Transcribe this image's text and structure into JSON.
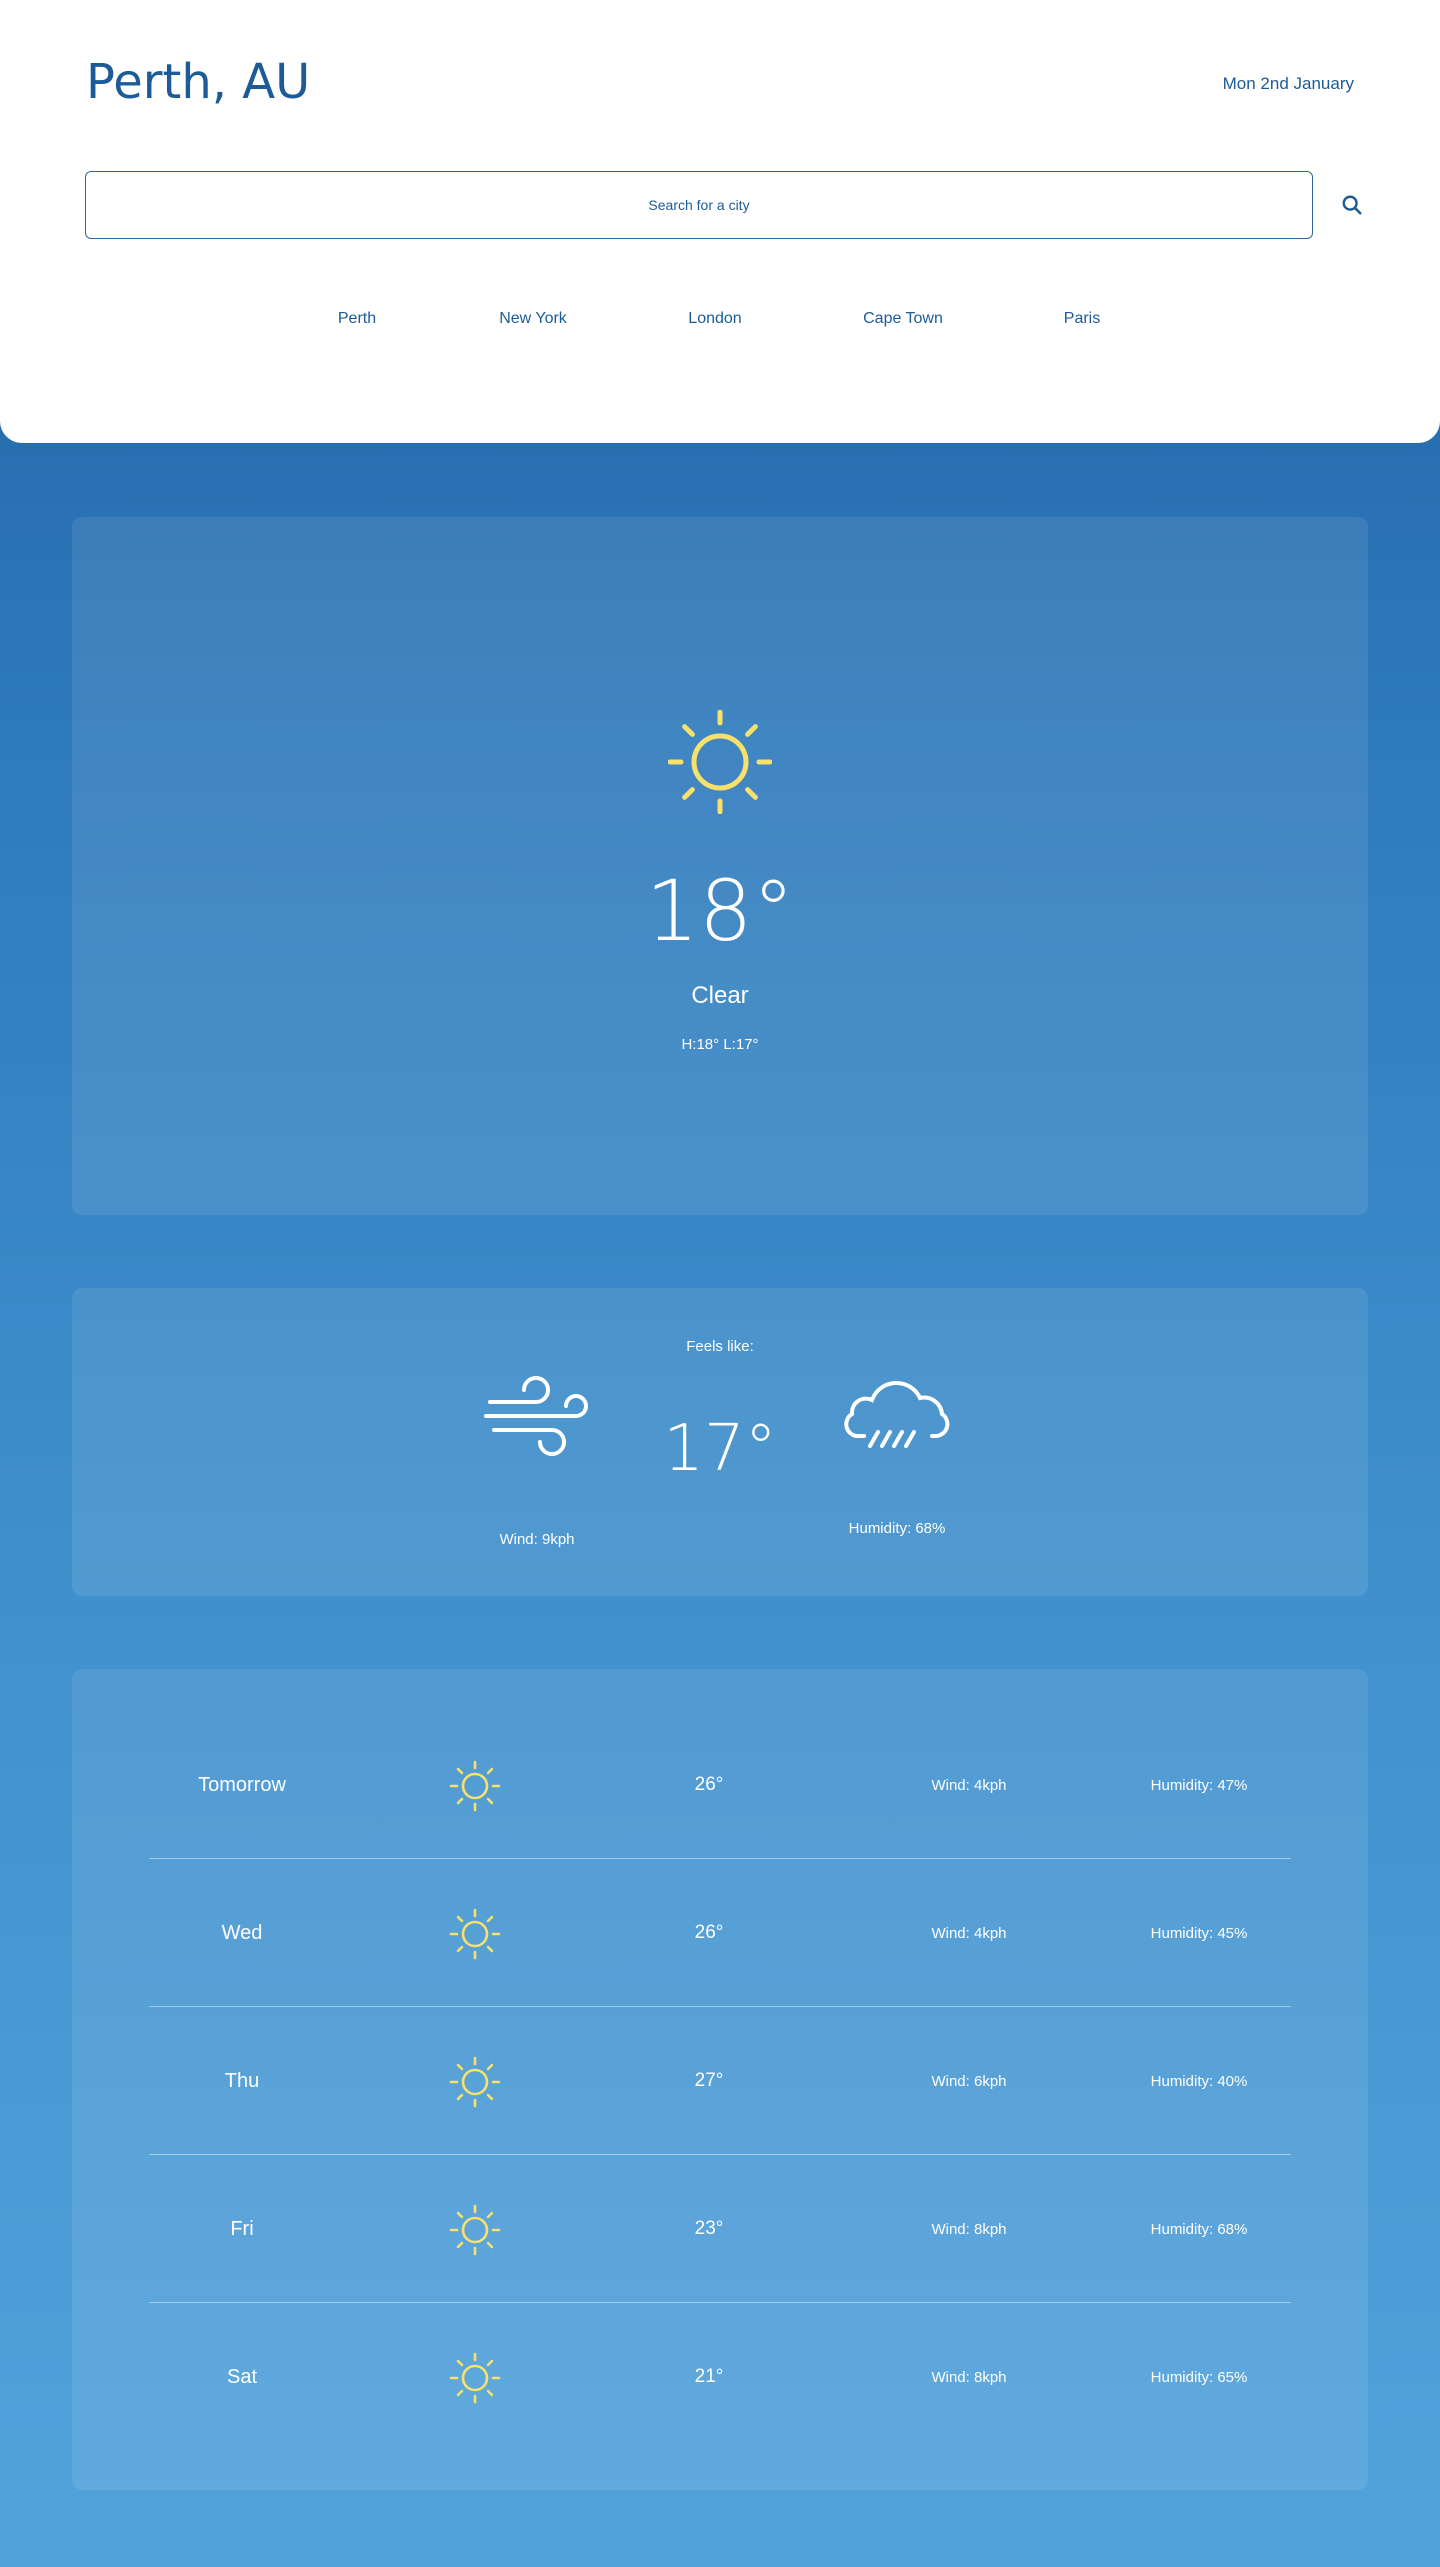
{
  "header": {
    "city_title": "Perth, AU",
    "date": "Mon 2nd January"
  },
  "search": {
    "placeholder": "Search for a city",
    "button_icon": "search-icon"
  },
  "quick_cities": [
    "Perth",
    "New York",
    "London",
    "Cape Town",
    "Paris"
  ],
  "current": {
    "icon": "sun-icon",
    "temperature": "18°",
    "condition": "Clear",
    "high_low": "H:18° L:17°"
  },
  "details": {
    "feels_like_label": "Feels like:",
    "feels_like_temp": "17°",
    "wind_icon": "wind-icon",
    "wind": "Wind: 9kph",
    "humidity_icon": "rain-cloud-icon",
    "humidity": "Humidity: 68%"
  },
  "forecast": [
    {
      "day": "Tomorrow",
      "icon": "sun-icon",
      "temp": "26°",
      "wind": "Wind: 4kph",
      "humidity": "Humidity: 47%"
    },
    {
      "day": "Wed",
      "icon": "sun-icon",
      "temp": "26°",
      "wind": "Wind: 4kph",
      "humidity": "Humidity: 45%"
    },
    {
      "day": "Thu",
      "icon": "sun-icon",
      "temp": "27°",
      "wind": "Wind: 6kph",
      "humidity": "Humidity: 40%"
    },
    {
      "day": "Fri",
      "icon": "sun-icon",
      "temp": "23°",
      "wind": "Wind: 8kph",
      "humidity": "Humidity: 68%"
    },
    {
      "day": "Sat",
      "icon": "sun-icon",
      "temp": "21°",
      "wind": "Wind: 8kph",
      "humidity": "Humidity: 65%"
    }
  ],
  "colors": {
    "brand_blue": "#1d5b98",
    "sun_yellow": "#f7e16a",
    "background_top": "#1f5f9f",
    "background_bottom": "#52a3dc"
  }
}
